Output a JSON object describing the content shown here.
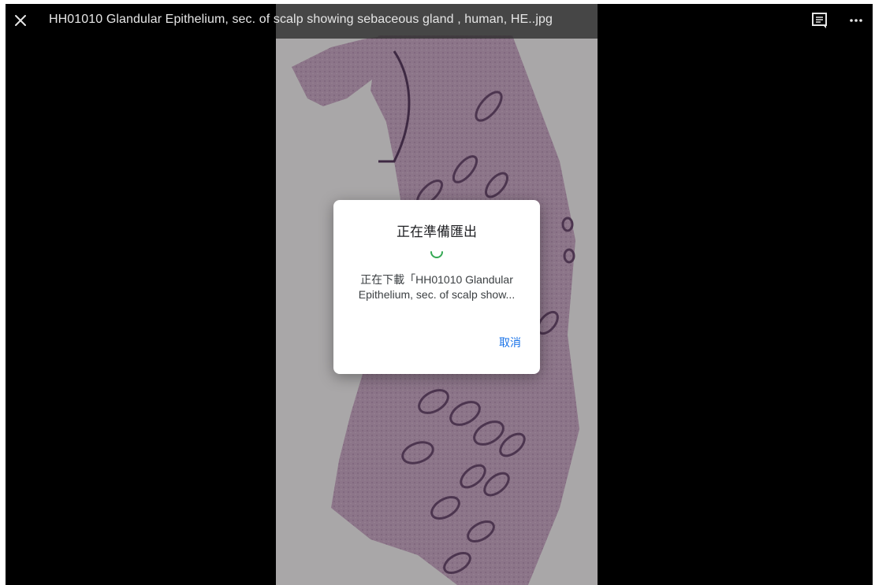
{
  "topbar": {
    "title": "HH01010 Glandular Epithelium, sec. of scalp showing sebaceous gland , human, HE..jpg",
    "close_icon": "close-icon",
    "comment_icon": "comment-icon",
    "more_icon": "more-horizontal-icon"
  },
  "dialog": {
    "title": "正在準備匯出",
    "message_line1": "正在下載「HH01010 Glandular",
    "message_line2": "Epithelium, sec. of scalp show...",
    "cancel_label": "取消",
    "spinner_icon": "loading-spinner-icon"
  },
  "colors": {
    "accent": "#1a73e8",
    "spinner": "#34a853",
    "background": "#000000",
    "dialog_bg": "#ffffff"
  }
}
